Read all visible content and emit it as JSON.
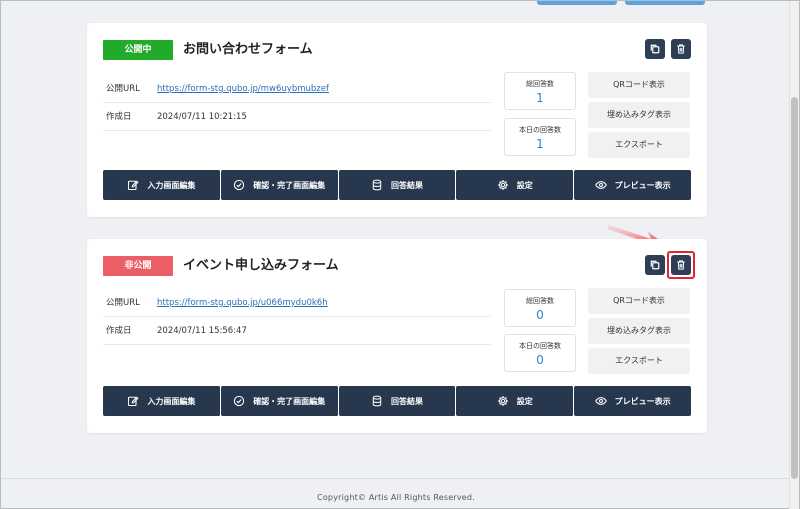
{
  "forms": [
    {
      "status": "公開中",
      "title": "お問い合わせフォーム",
      "public_url_label": "公開URL",
      "public_url": "https://form-stg.qubo.jp/mw6uybmubzef",
      "created_label": "作成日",
      "created_at": "2024/07/11 10:21:15",
      "total_responses_label": "総回答数",
      "total_responses": "1",
      "today_responses_label": "本日の回答数",
      "today_responses": "1",
      "side_buttons": [
        "QRコード表示",
        "埋め込みタグ表示",
        "エクスポート"
      ],
      "actions": [
        "入力画面編集",
        "確認・完了画面編集",
        "回答結果",
        "設定",
        "プレビュー表示"
      ]
    },
    {
      "status": "非公開",
      "title": "イベント申し込みフォーム",
      "public_url_label": "公開URL",
      "public_url": "https://form-stg.qubo.jp/u066mydu0k6h",
      "created_label": "作成日",
      "created_at": "2024/07/11 15:56:47",
      "total_responses_label": "総回答数",
      "total_responses": "0",
      "today_responses_label": "本日の回答数",
      "today_responses": "0",
      "side_buttons": [
        "QRコード表示",
        "埋め込みタグ表示",
        "エクスポート"
      ],
      "actions": [
        "入力画面編集",
        "確認・完了画面編集",
        "回答結果",
        "設定",
        "プレビュー表示"
      ]
    }
  ],
  "footer": {
    "copyright": "Copyright© Artis All Rights Reserved."
  },
  "icons": {
    "copy": "copy-icon",
    "delete": "trash-icon",
    "edit": "edit-icon",
    "confirm": "check-circle-icon",
    "results": "database-icon",
    "settings": "gear-icon",
    "preview": "eye-icon"
  },
  "colors": {
    "public_badge": "#22aa2a",
    "private_badge": "#ec5e66",
    "action_bar": "#27384e",
    "link": "#2b6fb6",
    "stat_value": "#2f86c9",
    "highlight": "#e0262e"
  }
}
